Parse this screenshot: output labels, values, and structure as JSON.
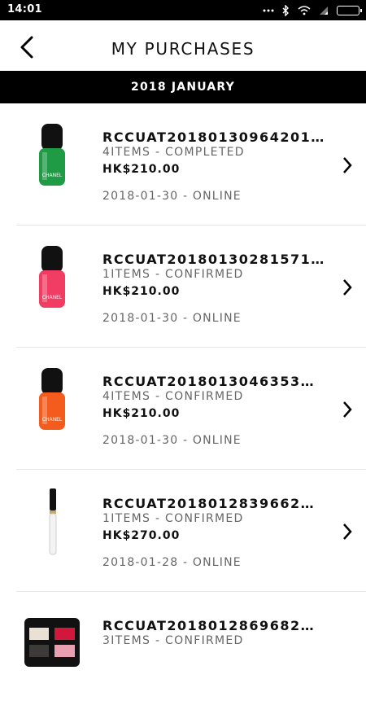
{
  "status_bar": {
    "time": "14:01"
  },
  "header": {
    "title": "MY PURCHASES"
  },
  "section": {
    "month": "2018 JANUARY"
  },
  "orders": [
    {
      "order_no": "RCCUAT20180130964201…",
      "status": "4ITEMS - COMPLETED",
      "price": "HK$210.00",
      "meta": "2018-01-30 - ONLINE",
      "product_color": "#1f9a45"
    },
    {
      "order_no": "RCCUAT20180130281571…",
      "status": "1ITEMS - CONFIRMED",
      "price": "HK$210.00",
      "meta": "2018-01-30 - ONLINE",
      "product_color": "#f13c63"
    },
    {
      "order_no": "RCCUAT2018013046353…",
      "status": "4ITEMS - CONFIRMED",
      "price": "HK$210.00",
      "meta": "2018-01-30 - ONLINE",
      "product_color": "#f45c1d"
    },
    {
      "order_no": "RCCUAT2018012839662…",
      "status": "1ITEMS - CONFIRMED",
      "price": "HK$270.00",
      "meta": "2018-01-28 - ONLINE",
      "product_color": "#d8d8d8"
    },
    {
      "order_no": "RCCUAT2018012869682…",
      "status": "3ITEMS - CONFIRMED",
      "price": "",
      "meta": "",
      "product_color": "#111111"
    }
  ]
}
